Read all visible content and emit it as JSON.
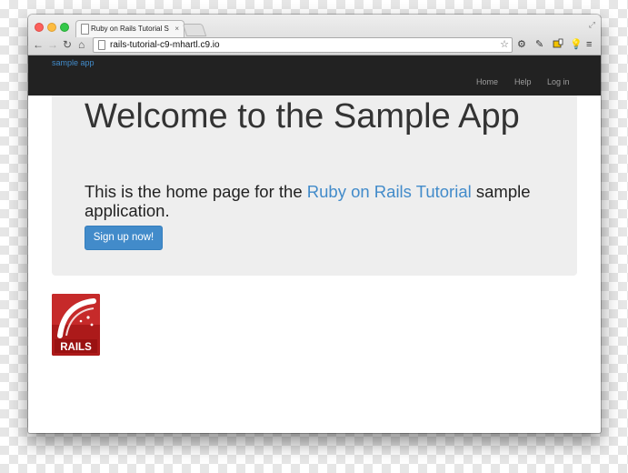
{
  "browser": {
    "tab_title": "Ruby on Rails Tutorial Sam",
    "tab_close": "×",
    "url": "rails-tutorial-c9-mhartl.c9.io",
    "icons": [
      "back-icon",
      "forward-icon",
      "reload-icon",
      "home-icon",
      "page-icon",
      "star-icon",
      "gear-icon",
      "pen-icon",
      "extension-icon",
      "lightbulb-icon",
      "menu-icon",
      "fullscreen-icon"
    ]
  },
  "navbar": {
    "brand": "sample app",
    "items": [
      {
        "label": "Home"
      },
      {
        "label": "Help"
      },
      {
        "label": "Log in"
      }
    ]
  },
  "jumbotron": {
    "heading": "Welcome to the Sample App",
    "lead_before": "This is the home page for the ",
    "lead_link": "Ruby on Rails Tutorial",
    "lead_after": " sample application.",
    "signup_label": "Sign up now!"
  },
  "footer_logo": {
    "text": "RAILS"
  },
  "colors": {
    "navbar_bg": "#222222",
    "link": "#428bca",
    "jumbotron_bg": "#eeeeee",
    "logo_red": "#ac1a1a"
  }
}
